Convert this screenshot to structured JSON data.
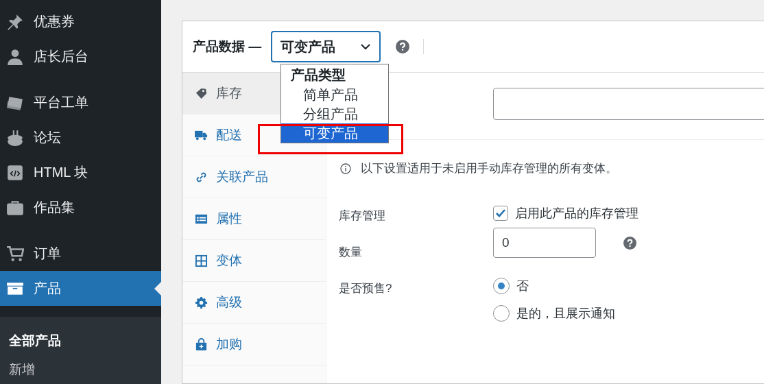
{
  "admin_menu": {
    "groups": [
      [
        {
          "label": "优惠券",
          "selected": false
        },
        {
          "label": "店长后台",
          "selected": false
        }
      ],
      [
        {
          "label": "平台工单",
          "selected": false
        },
        {
          "label": "论坛",
          "selected": false
        },
        {
          "label": "HTML 块",
          "selected": false
        },
        {
          "label": "作品集",
          "selected": false
        }
      ],
      [
        {
          "label": "订单",
          "selected": false
        },
        {
          "label": "产品",
          "selected": true
        }
      ]
    ],
    "submenu": [
      {
        "label": "全部产品",
        "selected": true
      },
      {
        "label": "新增",
        "selected": false
      }
    ]
  },
  "product_data": {
    "title": "产品数据 —",
    "type_select": {
      "value": "可变产品",
      "expanded": true,
      "dropdown": {
        "group_label": "产品类型",
        "options": [
          {
            "label": "简单产品",
            "selected": false
          },
          {
            "label": "分组产品",
            "selected": false
          },
          {
            "label": "可变产品",
            "selected": true
          }
        ]
      }
    },
    "tabs": [
      {
        "label": "库存",
        "selected": true
      },
      {
        "label": "配送",
        "selected": false
      },
      {
        "label": "关联产品",
        "selected": false
      },
      {
        "label": "属性",
        "selected": false
      },
      {
        "label": "变体",
        "selected": false
      },
      {
        "label": "高级",
        "selected": false
      },
      {
        "label": "加购",
        "selected": false
      }
    ],
    "notice": "以下设置适用于未启用手动库存管理的所有变体。",
    "rows": [
      {
        "kind": "checkbox",
        "label": "库存管理",
        "text": "启用此产品的库存管理",
        "checked": true
      },
      {
        "kind": "number",
        "label": "数量",
        "value": "0"
      },
      {
        "kind": "radio",
        "label": "是否预售?",
        "options": [
          {
            "label": "否",
            "selected": true
          },
          {
            "label": "是的，且展示通知",
            "selected": false
          }
        ]
      }
    ]
  }
}
